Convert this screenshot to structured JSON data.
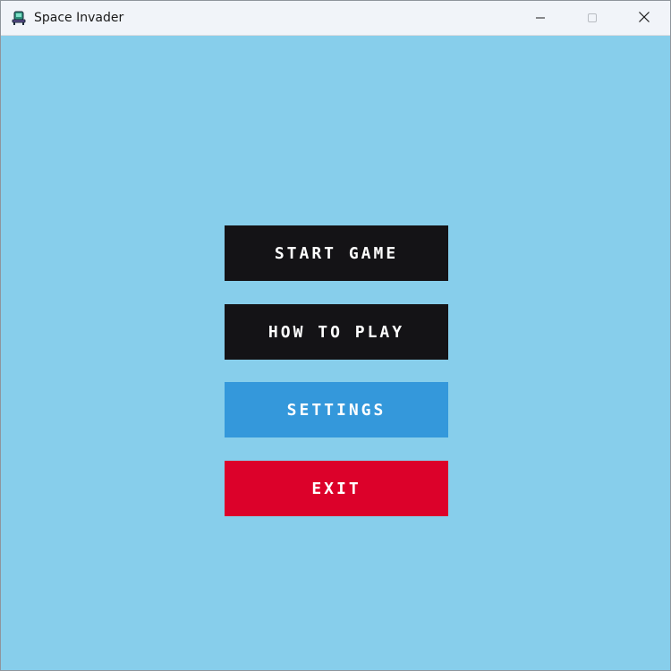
{
  "window": {
    "title": "Space Invader",
    "app_icon": "space-invader-icon",
    "controls": [
      "minimize-icon",
      "maximize-icon",
      "close-icon"
    ]
  },
  "background_color": "#87ceeb",
  "menu": {
    "buttons": [
      {
        "label": "START GAME",
        "color": "#141316"
      },
      {
        "label": "HOW TO PLAY",
        "color": "#141316"
      },
      {
        "label": "SETTINGS",
        "color": "#3498db"
      },
      {
        "label": "EXIT",
        "color": "#dc012a"
      }
    ]
  }
}
